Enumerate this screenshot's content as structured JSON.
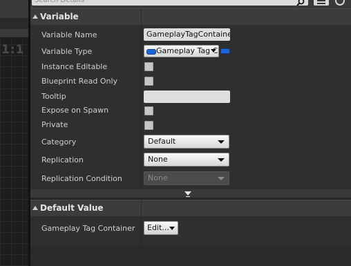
{
  "viewport": {
    "aspect_ratio_label": "1:1"
  },
  "search": {
    "placeholder": "Search Details"
  },
  "categories": {
    "variable": "Variable",
    "default_value": "Default Value"
  },
  "variable": {
    "name_label": "Variable Name",
    "name_value": "GameplayTagContainer",
    "type_label": "Variable Type",
    "type_value": "Gameplay Tag C",
    "instance_editable_label": "Instance Editable",
    "blueprint_read_only_label": "Blueprint Read Only",
    "tooltip_label": "Tooltip",
    "tooltip_value": "",
    "expose_on_spawn_label": "Expose on Spawn",
    "private_label": "Private",
    "category_label": "Category",
    "category_value": "Default",
    "replication_label": "Replication",
    "replication_value": "None",
    "replication_condition_label": "Replication Condition",
    "replication_condition_value": "None"
  },
  "default_value": {
    "gameplay_tag_container_label": "Gameplay Tag Container",
    "edit_button_label": "Edit..."
  },
  "colors": {
    "pin_blue": "#1e66d8",
    "panel_bg": "#2f2f2f",
    "header_bg": "#3c3c3c"
  }
}
